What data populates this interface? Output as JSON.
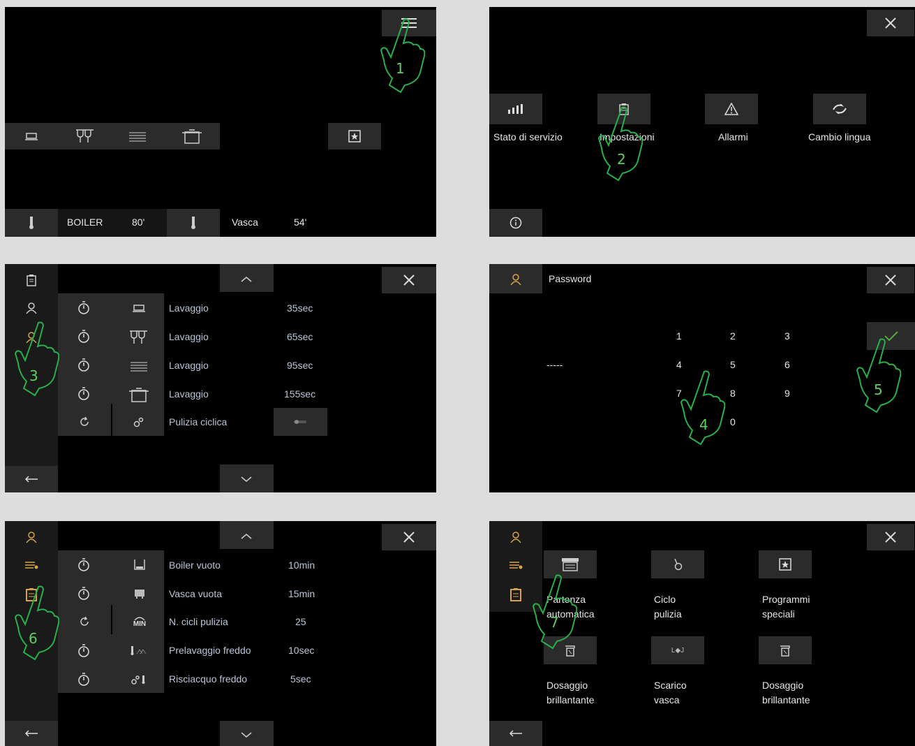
{
  "p1": {
    "bottom": {
      "boiler_label": "BOILER",
      "boiler_temp": "80'",
      "vasca_label": "Vasca",
      "vasca_temp": "54'"
    },
    "step": "1"
  },
  "p2": {
    "items": [
      {
        "label": "Stato di servizio",
        "icon": "signal-bars-icon"
      },
      {
        "label": "Impostazioni",
        "icon": "clipboard-icon"
      },
      {
        "label": "Allarmi",
        "icon": "warning-icon"
      },
      {
        "label": "Cambio lingua",
        "icon": "language-icon"
      }
    ],
    "step": "2"
  },
  "p3": {
    "rows": [
      {
        "label": "Lavaggio",
        "value": "35sec",
        "icon": "cup-icon"
      },
      {
        "label": "Lavaggio",
        "value": "65sec",
        "icon": "glasses-icon"
      },
      {
        "label": "Lavaggio",
        "value": "95sec",
        "icon": "plates-icon"
      },
      {
        "label": "Lavaggio",
        "value": "155sec",
        "icon": "pot-icon"
      },
      {
        "label": "Pulizia ciclica",
        "value": "",
        "icon": "drops-icon"
      }
    ],
    "step": "3"
  },
  "p4": {
    "title": "Password",
    "dashes": "-----",
    "keys": [
      "1",
      "2",
      "3",
      "4",
      "5",
      "6",
      "7",
      "8",
      "9",
      "0"
    ],
    "step_a": "4",
    "step_b": "5"
  },
  "p5": {
    "rows": [
      {
        "label": "Boiler vuoto",
        "value": "10min",
        "icon": "boiler-max-icon"
      },
      {
        "label": "Vasca vuota",
        "value": "15min",
        "icon": "tank-icon"
      },
      {
        "label": "N. cicli pulizia",
        "value": "25",
        "icon": "min-icon"
      },
      {
        "label": "Prelavaggio freddo",
        "value": "10sec",
        "icon": "prewash-icon"
      },
      {
        "label": "Risciacquo freddo",
        "value": "5sec",
        "icon": "rinse-icon"
      }
    ],
    "min_text": "MIN",
    "step": "6"
  },
  "p6": {
    "items": [
      {
        "line1": "Partenza",
        "line2": "automatica"
      },
      {
        "line1": "Ciclo",
        "line2": "pulizia"
      },
      {
        "line1": "Programmi",
        "line2": "speciali"
      },
      {
        "line1": "Dosaggio",
        "line2": "brillantante"
      },
      {
        "line1": "Scarico",
        "line2": "vasca"
      },
      {
        "line1": "Dosaggio",
        "line2": "brillantante"
      }
    ],
    "lod_text": "L◆J",
    "step": "7"
  }
}
